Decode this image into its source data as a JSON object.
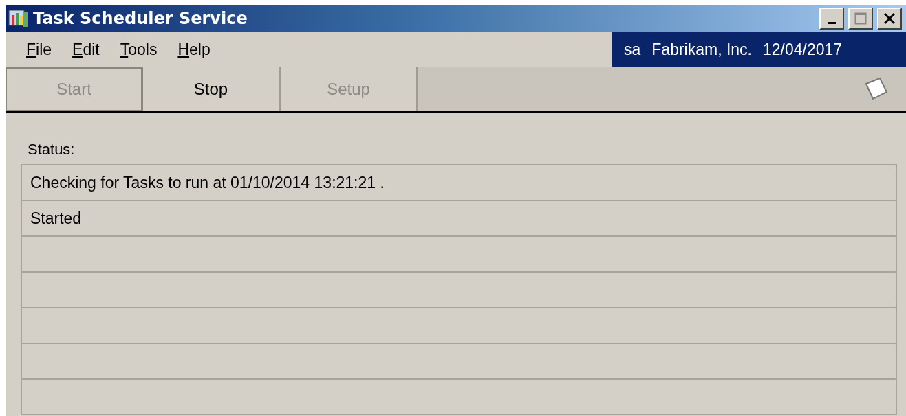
{
  "window": {
    "title": "Task Scheduler Service"
  },
  "menu": [
    {
      "label": "File"
    },
    {
      "label": "Edit"
    },
    {
      "label": "Tools"
    },
    {
      "label": "Help"
    }
  ],
  "session": {
    "user": "sa",
    "company": "Fabrikam, Inc.",
    "date": "12/04/2017"
  },
  "toolbar": [
    {
      "label": "Start",
      "disabled": true
    },
    {
      "label": "Stop",
      "disabled": false
    },
    {
      "label": "Setup",
      "disabled": true
    }
  ],
  "status": {
    "label": "Status:",
    "lines": [
      "Checking for Tasks to run at 01/10/2014 13:21:21 .",
      "Started"
    ]
  }
}
